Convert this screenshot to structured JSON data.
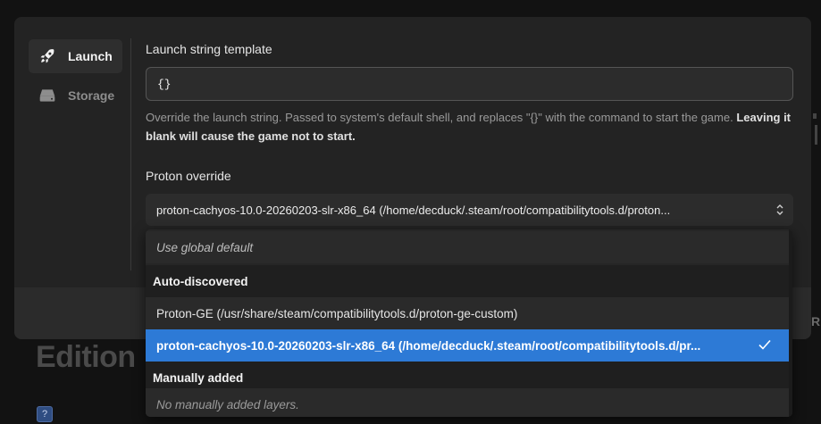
{
  "background": {
    "heading": "Edition",
    "edge_letter": "R",
    "icon_glyph": "?"
  },
  "sidebar": {
    "items": [
      {
        "label": "Launch",
        "icon": "rocket-icon",
        "active": true
      },
      {
        "label": "Storage",
        "icon": "drive-icon",
        "active": false
      }
    ]
  },
  "launch": {
    "template_label": "Launch string template",
    "template_value": "{}",
    "help_text": "Override the launch string. Passed to system's default shell, and replaces \"{}\" with the command to start the game. ",
    "help_warning": "Leaving it blank will cause the game not to start.",
    "proton_label": "Proton override",
    "proton_selected": "proton-cachyos-10.0-20260203-slr-x86_64 (/home/decduck/.steam/root/compatibilitytools.d/proton..."
  },
  "dropdown": {
    "global_default": "Use global default",
    "auto_header": "Auto-discovered",
    "options": [
      "Proton-GE (/usr/share/steam/compatibilitytools.d/proton-ge-custom)",
      "proton-cachyos-10.0-20260203-slr-x86_64 (/home/decduck/.steam/root/compatibilitytools.d/pr..."
    ],
    "manual_header": "Manually added",
    "manual_empty": "No manually added layers."
  },
  "colors": {
    "accent": "#2d7ad6",
    "modal": "#232323",
    "background": "#121212"
  }
}
